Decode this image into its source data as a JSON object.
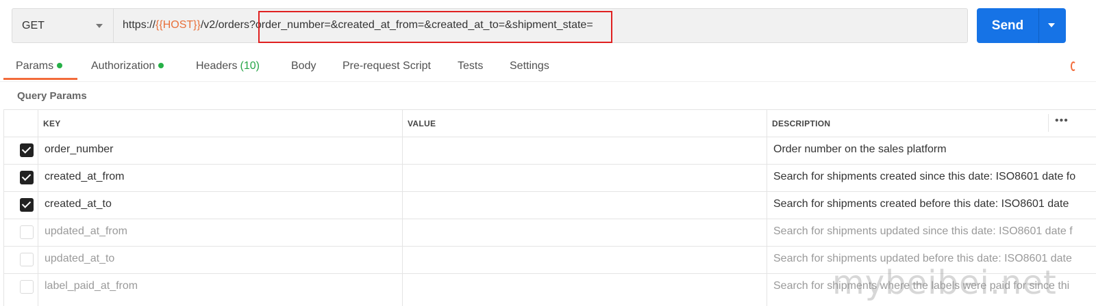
{
  "request": {
    "method": "GET",
    "url_prefix": "https://",
    "url_variable": "{{HOST}}",
    "url_path": "/v2/orders?",
    "url_query": "order_number=&created_at_from=&created_at_to=&shipment_state="
  },
  "send": {
    "label": "Send"
  },
  "tabs": [
    {
      "label": "Params",
      "dot": true,
      "active": true
    },
    {
      "label": "Authorization",
      "dot": true
    },
    {
      "label": "Headers",
      "count": "(10)"
    },
    {
      "label": "Body"
    },
    {
      "label": "Pre-request Script"
    },
    {
      "label": "Tests"
    },
    {
      "label": "Settings"
    }
  ],
  "params": {
    "title": "Query Params",
    "columns": {
      "key": "KEY",
      "value": "VALUE",
      "description": "DESCRIPTION"
    },
    "more_label": "•••",
    "rows": [
      {
        "enabled": true,
        "key": "order_number",
        "value": "",
        "description": "Order number on the sales platform"
      },
      {
        "enabled": true,
        "key": "created_at_from",
        "value": "",
        "description": "Search for shipments created since this date: ISO8601 date fo"
      },
      {
        "enabled": true,
        "key": "created_at_to",
        "value": "",
        "description": "Search for shipments created before this date: ISO8601 date"
      },
      {
        "enabled": false,
        "key": "updated_at_from",
        "value": "",
        "description": "Search for shipments updated since this date: ISO8601 date f"
      },
      {
        "enabled": false,
        "key": "updated_at_to",
        "value": "",
        "description": "Search for shipments updated before this date: ISO8601 date"
      },
      {
        "enabled": false,
        "key": "label_paid_at_from",
        "value": "",
        "description": "Search for shipments where the labels were paid for since thi"
      }
    ]
  },
  "watermark": "mybeibei.net",
  "colors": {
    "send": "#1673e6",
    "accent": "#f26b3a",
    "dot": "#26b047",
    "highlight": "#e02020"
  }
}
